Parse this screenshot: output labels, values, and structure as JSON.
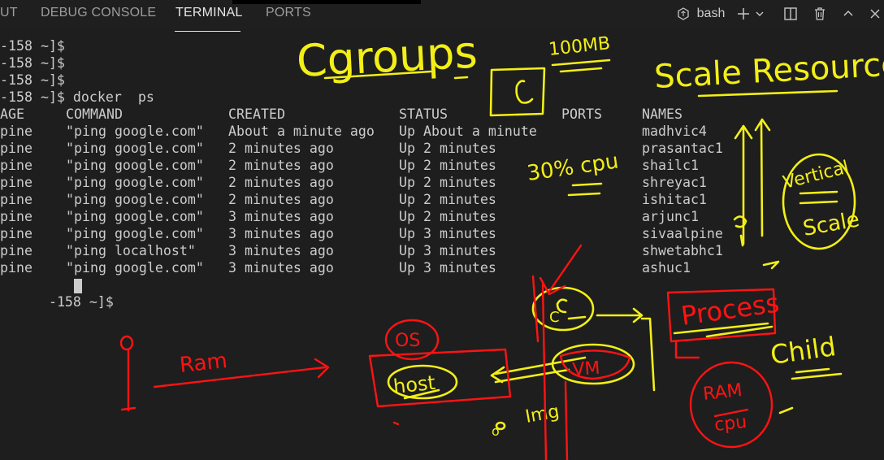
{
  "panel": {
    "tabs": [
      {
        "label": "UT"
      },
      {
        "label": "DEBUG CONSOLE"
      },
      {
        "label": "TERMINAL"
      },
      {
        "label": "PORTS"
      }
    ],
    "active_tab": "TERMINAL",
    "shell_label": "bash"
  },
  "terminal": {
    "prompt_lines": [
      "-158 ~]$",
      "-158 ~]$",
      "-158 ~]$",
      "-158 ~]$ docker  ps"
    ],
    "table_headers": [
      "AGE",
      "COMMAND",
      "CREATED",
      "STATUS",
      "PORTS",
      "NAMES"
    ],
    "rows": [
      [
        "pine",
        "\"ping google.com\"",
        "About a minute ago",
        "Up About a minute",
        "",
        "madhvic4"
      ],
      [
        "pine",
        "\"ping google.com\"",
        "2 minutes ago",
        "Up 2 minutes",
        "",
        "prasantac1"
      ],
      [
        "pine",
        "\"ping google.com\"",
        "2 minutes ago",
        "Up 2 minutes",
        "",
        "shailc1"
      ],
      [
        "pine",
        "\"ping google.com\"",
        "2 minutes ago",
        "Up 2 minutes",
        "",
        "shreyac1"
      ],
      [
        "pine",
        "\"ping google.com\"",
        "2 minutes ago",
        "Up 2 minutes",
        "",
        "ishitac1"
      ],
      [
        "pine",
        "\"ping google.com\"",
        "3 minutes ago",
        "Up 2 minutes",
        "",
        "arjunc1"
      ],
      [
        "pine",
        "\"ping google.com\"",
        "3 minutes ago",
        "Up 3 minutes",
        "",
        "sivaalpine"
      ],
      [
        "pine",
        "\"ping localhost\"",
        "3 minutes ago",
        "Up 3 minutes",
        "",
        "shwetabhc1"
      ],
      [
        "pine",
        "\"ping google.com\"",
        "3 minutes ago",
        "Up 3 minutes",
        "",
        "ashuc1"
      ]
    ],
    "final_prompt": "-158 ~]$"
  },
  "annotations": {
    "cgroups": "Cgroups",
    "mem": "100MB",
    "c": "C",
    "scale_resource": "Scale Resource",
    "cpu_pct": "30% cpu",
    "vertical": "Vertical",
    "scale": "Scale",
    "ram_arrow": "Ram",
    "os": "OS",
    "host": "host",
    "c2": "C",
    "vm": "VM",
    "img": "Img",
    "process": "Process",
    "child": "Child",
    "ram": "RAM",
    "cpu": "cpu",
    "o_small": "o",
    "circle_o": "O"
  },
  "colors": {
    "background": "#1e1e1e",
    "text": "#cccccc",
    "tab_inactive": "#9d9d9d",
    "tab_active": "#e7e7e7",
    "ink_yellow": "#f3ef16",
    "ink_red": "#ff1313"
  },
  "icons": [
    "terminal-bash-icon",
    "add-icon",
    "chevron-down-icon",
    "split-terminal-icon",
    "trash-icon",
    "chevron-up-icon",
    "close-icon"
  ]
}
